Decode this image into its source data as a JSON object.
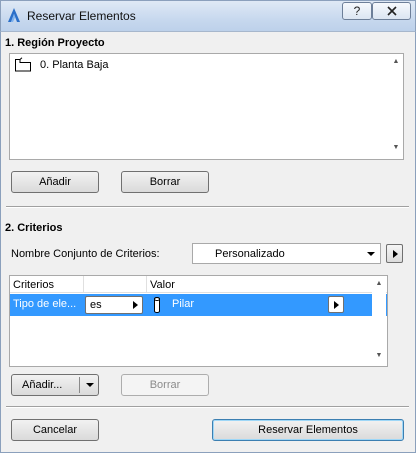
{
  "window": {
    "title": "Reservar Elementos",
    "help_glyph": "?",
    "close_glyph": "X",
    "accent": "#3399ff"
  },
  "region": {
    "title": "1. Región Proyecto",
    "items": [
      {
        "icon": "floor-plan-icon",
        "label": "0. Planta Baja"
      }
    ],
    "add_label": "Añadir",
    "delete_label": "Borrar"
  },
  "criteria": {
    "title": "2. Criterios",
    "set_name_label": "Nombre Conjunto de Criterios:",
    "set_name_value": "Personalizado",
    "columns": [
      "Criterios",
      "",
      "Valor"
    ],
    "rows": [
      {
        "criterion": "Tipo de ele...",
        "operator": "es",
        "value_icon": "column-icon",
        "value": "Pilar"
      }
    ],
    "add_label": "Añadir...",
    "delete_label": "Borrar"
  },
  "footer": {
    "cancel_label": "Cancelar",
    "reserve_label": "Reservar Elementos"
  }
}
